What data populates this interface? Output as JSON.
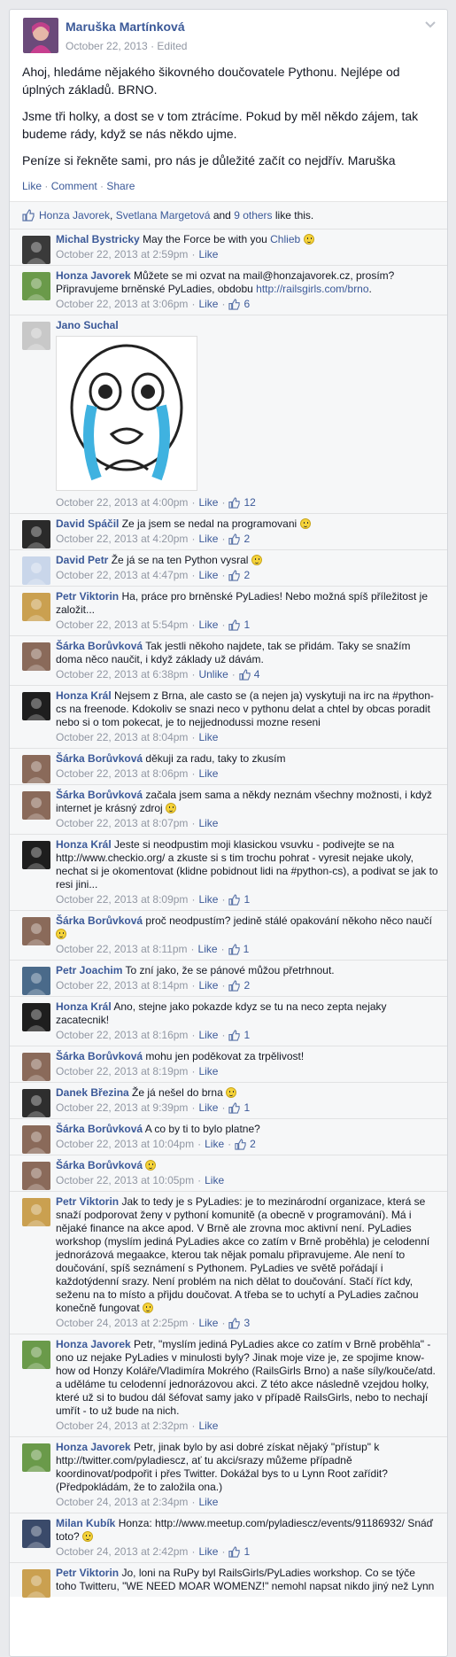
{
  "post": {
    "author": "Maruška Martínková",
    "date": "October 22, 2013",
    "edited": "Edited",
    "paragraphs": [
      "Ahoj, hledáme nějakého šikovného doučovatele Pythonu. Nejlépe od úplných základů. BRNO.",
      "Jsme tři holky, a dost se v tom ztrácíme. Pokud by měl někdo zájem, tak budeme rády, když se nás někdo ujme.",
      "Peníze si řekněte sami, pro nás je důležité začít co nejdřív. Maruška"
    ],
    "actions": {
      "like": "Like",
      "comment": "Comment",
      "share": "Share"
    }
  },
  "likes_bar": {
    "name1": "Honza Javorek",
    "comma": ",",
    "name2": "Svetlana Margetová",
    "and": "and",
    "others": "9 others",
    "tail": "like this."
  },
  "comments": [
    {
      "name": "Michal Bystricky",
      "text": "May the Force be with you",
      "link": "Chlieb",
      "emoji": true,
      "time": "October 22, 2013 at 2:59pm",
      "like": "Like",
      "count": ""
    },
    {
      "name": "Honza Javorek",
      "text": "Můžete se mi ozvat na mail@honzajavorek.cz, prosím? Připravujeme brněnské PyLadies, obdobu",
      "link": "http://railsgirls.com/brno",
      "tail": ".",
      "time": "October 22, 2013 at 3:06pm",
      "like": "Like",
      "count": "6"
    },
    {
      "name": "Jano Suchal",
      "text": "",
      "time": "October 22, 2013 at 4:00pm",
      "like": "Like",
      "count": "12"
    },
    {
      "name": "David Spáčil",
      "text": "Ze ja jsem se nedal na programovani",
      "emoji": true,
      "time": "October 22, 2013 at 4:20pm",
      "like": "Like",
      "count": "2"
    },
    {
      "name": "David Petr",
      "text": "Že já se na ten Python vysral",
      "emoji": true,
      "time": "October 22, 2013 at 4:47pm",
      "like": "Like",
      "count": "2"
    },
    {
      "name": "Petr Viktorin",
      "text": "Ha, práce pro brněnské PyLadies! Nebo možná spíš příležitost je založit...",
      "time": "October 22, 2013 at 5:54pm",
      "like": "Like",
      "count": "1"
    },
    {
      "name": "Šárka Borůvková",
      "text": "Tak jestli někoho najdete, tak se přidám. Taky se snažím doma něco naučit, i když základy už dávám.",
      "time": "October 22, 2013 at 6:38pm",
      "like": "Unlike",
      "count": "4"
    },
    {
      "name": "Honza Král",
      "text": "Nejsem z Brna, ale casto se (a nejen ja) vyskytuji na irc na #python-cs na freenode. Kdokoliv se snazi neco v pythonu delat a chtel by obcas poradit nebo si o tom pokecat, je to nejjednodussi mozne reseni",
      "time": "October 22, 2013 at 8:04pm",
      "like": "Like",
      "count": ""
    },
    {
      "name": "Šárka Borůvková",
      "text": "děkuji za radu, taky to zkusím",
      "time": "October 22, 2013 at 8:06pm",
      "like": "Like",
      "count": ""
    },
    {
      "name": "Šárka Borůvková",
      "text": "začala jsem sama a někdy neznám všechny možnosti, i když internet je krásný zdroj",
      "emoji": true,
      "time": "October 22, 2013 at 8:07pm",
      "like": "Like",
      "count": ""
    },
    {
      "name": "Honza Král",
      "text": "Jeste si neodpustim moji klasickou vsuvku - podivejte se na http://www.checkio.org/ a zkuste si s tim trochu pohrat - vyresit nejake ukoly, nechat si je okomentovat (klidne pobidnout lidi na #python-cs), a podivat se jak to resi jini...",
      "time": "October 22, 2013 at 8:09pm",
      "like": "Like",
      "count": "1"
    },
    {
      "name": "Šárka Borůvková",
      "text": "proč neodpustím? jedině stálé opakování někoho něco naučí",
      "emoji": true,
      "time": "October 22, 2013 at 8:11pm",
      "like": "Like",
      "count": "1"
    },
    {
      "name": "Petr Joachim",
      "text": "To zní jako, že se pánové můžou přetrhnout.",
      "time": "October 22, 2013 at 8:14pm",
      "like": "Like",
      "count": "2"
    },
    {
      "name": "Honza Král",
      "text": "Ano, stejne jako pokazde kdyz se tu na neco zepta nejaky zacatecnik!",
      "time": "October 22, 2013 at 8:16pm",
      "like": "Like",
      "count": "1"
    },
    {
      "name": "Šárka Borůvková",
      "text": "mohu jen poděkovat za trpělivost!",
      "time": "October 22, 2013 at 8:19pm",
      "like": "Like",
      "count": ""
    },
    {
      "name": "Danek Březina",
      "text": "Že já nešel do brna",
      "emoji": true,
      "time": "October 22, 2013 at 9:39pm",
      "like": "Like",
      "count": "1"
    },
    {
      "name": "Šárka Borůvková",
      "text": "A co by ti to bylo platne?",
      "time": "October 22, 2013 at 10:04pm",
      "like": "Like",
      "count": "2"
    },
    {
      "name": "Šárka Borůvková",
      "text": "",
      "emoji": true,
      "time": "October 22, 2013 at 10:05pm",
      "like": "Like",
      "count": ""
    },
    {
      "name": "Petr Viktorin",
      "text": "Jak to tedy je s PyLadies: je to mezinárodní organizace, která se snaží podporovat ženy v pythoní komunitě (a obecně v programování). Má i nějaké finance na akce apod. V Brně ale zrovna moc aktivní není. PyLadies workshop (myslím jediná PyLadies akce co zatím v Brně proběhla) je celodenní jednorázová megaakce, kterou tak nějak pomalu připravujeme. Ale není to doučování, spíš seznámení s Pythonem. PyLadies ve světě pořádají i každotýdenní srazy. Není problém na nich dělat to doučování. Stačí říct kdy, seženu na to místo a přijdu doučovat. A třeba se to uchytí a PyLadies začnou konečně fungovat",
      "emoji": true,
      "time": "October 24, 2013 at 2:25pm",
      "like": "Like",
      "count": "3"
    },
    {
      "name": "Honza Javorek",
      "text": "Petr, \"myslím jediná PyLadies akce co zatím v Brně proběhla\" - ono uz nejake PyLadies v minulosti byly? Jinak moje vize je, ze spojime know-how od Honzy Koláře/Vladimíra Mokrého (RailsGirls Brno) a naše síly/kouče/atd. a uděláme tu celodenní jednorázovou akci. Z této akce následně vzejdou holky, které už si to budou dál šéfovat samy jako v případě RailsGirls, nebo to nechají umřít - to už bude na nich.",
      "time": "October 24, 2013 at 2:32pm",
      "like": "Like",
      "count": ""
    },
    {
      "name": "Honza Javorek",
      "text": "Petr, jinak bylo by asi dobré získat nějaký \"přístup\" k http://twitter.com/pyladiescz, ať tu akci/srazy můžeme případně koordinovat/podpořit i přes Twitter. Dokážal bys to u Lynn Root zařídit? (Předpokládám, že to založila ona.)",
      "time": "October 24, 2013 at 2:34pm",
      "like": "Like",
      "count": ""
    },
    {
      "name": "Milan Kubík",
      "text": "Honza: http://www.meetup.com/pyladiescz/events/91186932/ Snáď toto?",
      "emoji": true,
      "time": "October 24, 2013 at 2:42pm",
      "like": "Like",
      "count": "1"
    },
    {
      "name": "Petr Viktorin",
      "text": "Jo, loni na RuPy byl RailsGirls/PyLadies workshop. Co se týče toho Twitteru, \"WE NEED MOAR WOMENZ!\" nemohl napsat nikdo jiný než Lynn",
      "time": "",
      "like": "",
      "count": ""
    }
  ]
}
